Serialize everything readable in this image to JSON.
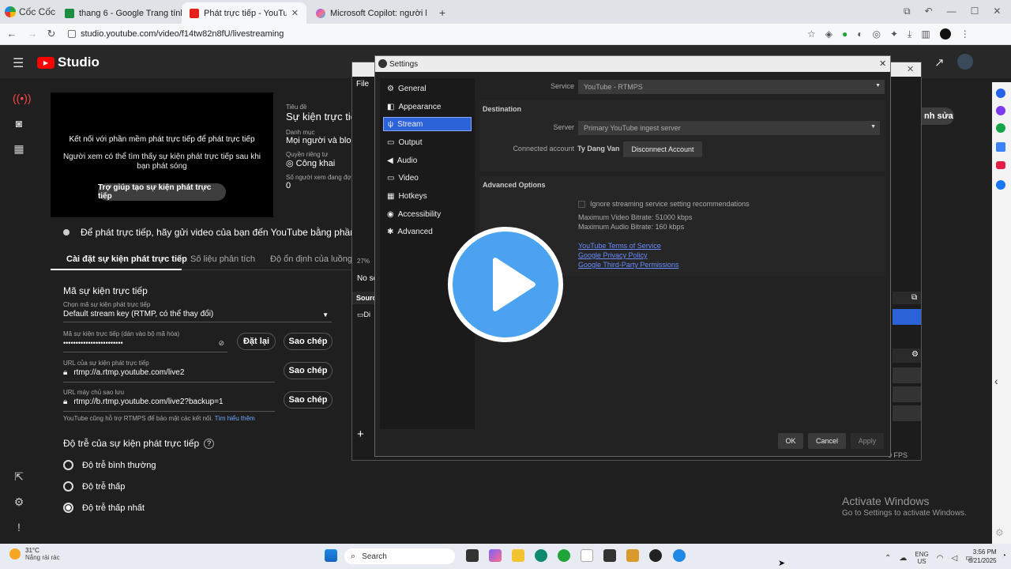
{
  "browser": {
    "brand": "Cốc Cốc",
    "tabs": [
      {
        "label": "thang 6 - Google Trang tính",
        "color": "#1e8e3e"
      },
      {
        "label": "Phát trực tiếp - YouTube Stud",
        "color": "#e62117"
      },
      {
        "label": "Microsoft Copilot: người bạn đồn",
        "color": "#7b61ff"
      }
    ],
    "url": "studio.youtube.com/video/f14tw82n8fU/livestreaming"
  },
  "studio": {
    "logo": "Studio",
    "preview": {
      "line1": "Kết nối với phần mềm phát trực tiếp để phát trực tiếp",
      "line2": "Người xem có thể tìm thấy sự kiện phát trực tiếp sau khi bạn phát sóng",
      "help_button": "Trợ giúp tạo sự kiện phát trực tiếp"
    },
    "info": {
      "title_label": "Tiêu đề",
      "title": "Sự kiện trực tiếp",
      "category_label": "Danh mục",
      "category": "Mọi người và blog",
      "privacy_label": "Quyền riêng tư",
      "privacy": "Công khai",
      "viewers_label": "Số người xem đang đợ",
      "viewers": "0"
    },
    "edit_button": "nh sửa",
    "notice": "Để phát trực tiếp, hãy gửi video của bạn đến YouTube bằng phần mềm p",
    "tabs": [
      "Cài đặt sự kiện phát trực tiếp",
      "Số liệu phân tích",
      "Độ ổn định của luồng dữ"
    ],
    "stream_key": {
      "heading": "Mã sự kiện trực tiếp",
      "select_label": "Chọn mã sự kiện phát trực tiếp",
      "select_value": "Default stream key (RTMP, có thể thay đổi)",
      "key_label": "Mã sự kiện trực tiếp (dán vào bộ mã hóa)",
      "key_value": "••••••••••••••••••••••••",
      "reset_button": "Đặt lại",
      "copy_button": "Sao chép",
      "url_label": "URL của sự kiện phát trực tiếp",
      "url_value": "rtmp://a.rtmp.youtube.com/live2",
      "backup_label": "URL máy chủ sao lưu",
      "backup_value": "rtmp://b.rtmp.youtube.com/live2?backup=1",
      "rtmps_note": "YouTube cũng hỗ trợ RTMPS để bảo mật các kết nối.",
      "learn_more": "Tìm hiểu thêm"
    },
    "latency": {
      "heading": "Độ trễ của sự kiện phát trực tiếp",
      "options": [
        "Độ trễ bình thường",
        "Độ trễ thấp",
        "Độ trễ thấp nhất"
      ],
      "selected": 2
    },
    "watermark": {
      "title": "Activate Windows",
      "sub": "Go to Settings to activate Windows."
    }
  },
  "obs": {
    "menu_file": "File",
    "percent": "27%",
    "no_source": "No sc",
    "sources": "Sourc",
    "source_item": "Di",
    "fps": "0 FPS"
  },
  "settings": {
    "title": "Settings",
    "nav": [
      "General",
      "Appearance",
      "Stream",
      "Output",
      "Audio",
      "Video",
      "Hotkeys",
      "Accessibility",
      "Advanced"
    ],
    "selected": 2,
    "service_label": "Service",
    "service_value": "YouTube - RTMPS",
    "destination": "Destination",
    "server_label": "Server",
    "server_value": "Primary YouTube ingest server",
    "account_label": "Connected account",
    "account_value": "Ty Dang Van",
    "disconnect": "Disconnect Account",
    "advanced": "Advanced Options",
    "ignore_label": "Ignore streaming service setting recommendations",
    "max_video": "Maximum Video Bitrate: 51000 kbps",
    "max_audio": "Maximum Audio Bitrate: 160 kbps",
    "links": [
      "YouTube Terms of Service",
      "Google Privacy Policy",
      "Google Third-Party Permissions"
    ],
    "ok": "OK",
    "cancel": "Cancel",
    "apply": "Apply"
  },
  "taskbar": {
    "weather_temp": "31°C",
    "weather_desc": "Nắng rải rác",
    "search": "Search",
    "lang1": "ENG",
    "lang2": "US",
    "time": "3:56 PM",
    "date": "6/21/2025"
  }
}
